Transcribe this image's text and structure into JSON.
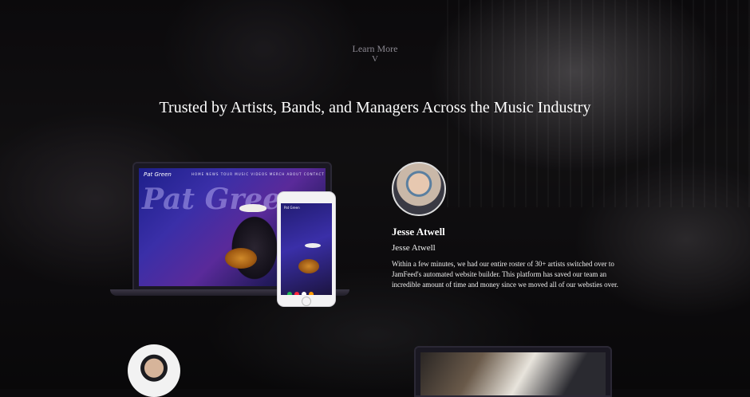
{
  "hero": {
    "learn_more": "Learn More",
    "chevron": "V"
  },
  "headline": "Trusted by Artists, Bands, and Managers Across the Music Industry",
  "mockup": {
    "site_brand": "Pat Green",
    "site_nav": "HOME NEWS TOUR MUSIC VIDEOS MERCH ABOUT CONTACT",
    "big_text": "Pat Green"
  },
  "testimonial": {
    "name": "Jesse Atwell",
    "role": "Jesse Atwell",
    "quote": "Within a few minutes, we had our entire roster of 30+ artists switched over to JamFeed's automated website builder. This platform has saved our team an incredible amount of time and money since we moved all of our websties over."
  },
  "colors": {
    "background": "#0b0a0c",
    "text": "#ffffff",
    "muted": "#8a8790",
    "site_accent": "#3a2fa8"
  }
}
